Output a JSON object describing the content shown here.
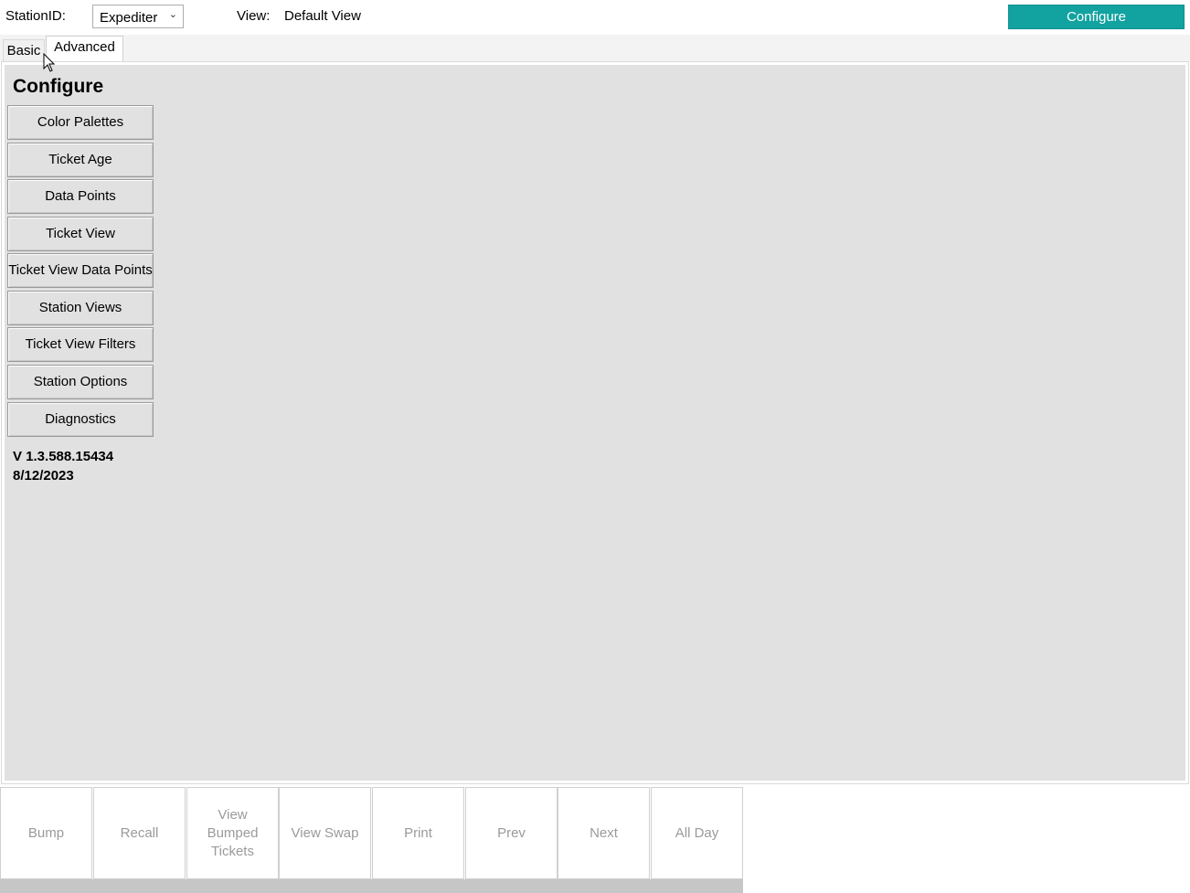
{
  "header": {
    "station_label": "StationID:",
    "station_value": "Expediter",
    "view_label": "View:",
    "view_value": "Default View",
    "configure_label": "Configure",
    "accent_color": "#12a2a0"
  },
  "tabs": [
    {
      "label": "Basic",
      "active": false
    },
    {
      "label": "Advanced",
      "active": true
    }
  ],
  "configure_panel": {
    "title": "Configure",
    "buttons": [
      {
        "label": "Color Palettes"
      },
      {
        "label": "Ticket Age"
      },
      {
        "label": "Data Points"
      },
      {
        "label": "Ticket View"
      },
      {
        "label": "Ticket View Data Points"
      },
      {
        "label": "Station Views"
      },
      {
        "label": "Ticket View Filters"
      },
      {
        "label": "Station Options"
      },
      {
        "label": "Diagnostics"
      }
    ],
    "version": "V 1.3.588.15434",
    "date": "8/12/2023"
  },
  "bottom_buttons": [
    {
      "label": "Bump"
    },
    {
      "label": "Recall"
    },
    {
      "label": "View Bumped Tickets"
    },
    {
      "label": "View Swap"
    },
    {
      "label": "Print"
    },
    {
      "label": "Prev"
    },
    {
      "label": "Next"
    },
    {
      "label": "All Day"
    }
  ]
}
